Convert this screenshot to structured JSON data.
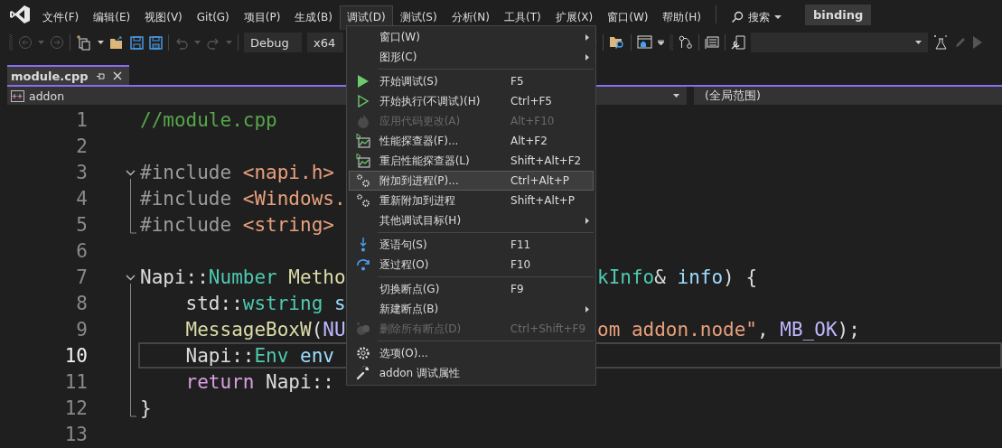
{
  "menubar": {
    "items": [
      {
        "label": "文件(F)",
        "selected": false
      },
      {
        "label": "编辑(E)",
        "selected": false
      },
      {
        "label": "视图(V)",
        "selected": false
      },
      {
        "label": "Git(G)",
        "selected": false
      },
      {
        "label": "项目(P)",
        "selected": false
      },
      {
        "label": "生成(B)",
        "selected": false
      },
      {
        "label": "调试(D)",
        "selected": true
      },
      {
        "label": "测试(S)",
        "selected": false
      },
      {
        "label": "分析(N)",
        "selected": false
      },
      {
        "label": "工具(T)",
        "selected": false
      },
      {
        "label": "扩展(X)",
        "selected": false
      },
      {
        "label": "窗口(W)",
        "selected": false
      },
      {
        "label": "帮助(H)",
        "selected": false
      }
    ],
    "search": {
      "label": "搜索"
    },
    "solution": "binding"
  },
  "toolbar": {
    "configuration": "Debug",
    "platform": "x64"
  },
  "tabs": [
    {
      "label": "module.cpp",
      "selected": true
    }
  ],
  "navbar": {
    "project": "addon",
    "scope": "(全局范围)"
  },
  "editor": {
    "lines": [
      {
        "number": "1",
        "current": false,
        "left": [
          {
            "text": "//module.cpp",
            "kind": "comment"
          }
        ]
      },
      {
        "number": "2",
        "current": false
      },
      {
        "number": "3",
        "current": false,
        "fold_open": true,
        "left": [
          {
            "text": "#include ",
            "kind": "preproc"
          },
          {
            "text": "<napi.h>",
            "kind": "string"
          }
        ]
      },
      {
        "number": "4",
        "current": false,
        "fold_guide": true,
        "left": [
          {
            "text": "#include ",
            "kind": "preproc"
          },
          {
            "text": "<Windows.",
            "kind": "string"
          }
        ]
      },
      {
        "number": "5",
        "current": false,
        "fold_end": true,
        "left": [
          {
            "text": "#include ",
            "kind": "preproc"
          },
          {
            "text": "<string>",
            "kind": "string"
          }
        ]
      },
      {
        "number": "6",
        "current": false
      },
      {
        "number": "7",
        "current": false,
        "fold_open": true,
        "left": [
          {
            "text": "Napi::",
            "kind": "plain"
          },
          {
            "text": "Number",
            "kind": "type"
          },
          {
            "text": " Metho",
            "kind": "function"
          }
        ],
        "right": [
          {
            "text": "kInfo",
            "kind": "type"
          },
          {
            "text": "& ",
            "kind": "plain"
          },
          {
            "text": "info",
            "kind": "param"
          },
          {
            "text": ") {",
            "kind": "plain"
          }
        ]
      },
      {
        "number": "8",
        "current": false,
        "fold_guide": true,
        "left": [
          {
            "text": "    std::",
            "kind": "plain"
          },
          {
            "text": "wstring",
            "kind": "type"
          },
          {
            "text": " s",
            "kind": "param"
          }
        ]
      },
      {
        "number": "9",
        "current": false,
        "fold_guide": true,
        "left": [
          {
            "text": "    MessageBoxW",
            "kind": "function"
          },
          {
            "text": "(",
            "kind": "plain"
          },
          {
            "text": "NU",
            "kind": "macro"
          }
        ],
        "right": [
          {
            "text": "om addon.node\"",
            "kind": "string"
          },
          {
            "text": ", ",
            "kind": "plain"
          },
          {
            "text": "MB_OK",
            "kind": "macro"
          },
          {
            "text": ");",
            "kind": "plain"
          }
        ]
      },
      {
        "number": "10",
        "current": true,
        "fold_guide": true,
        "left": [
          {
            "text": "    Napi::",
            "kind": "plain"
          },
          {
            "text": "Env",
            "kind": "type"
          },
          {
            "text": " env",
            "kind": "param"
          }
        ]
      },
      {
        "number": "11",
        "current": false,
        "fold_guide": true,
        "left": [
          {
            "text": "    return",
            "kind": "control"
          },
          {
            "text": " Napi::",
            "kind": "plain"
          }
        ]
      },
      {
        "number": "12",
        "current": false,
        "fold_end": true,
        "left": [
          {
            "text": "}",
            "kind": "plain"
          }
        ]
      },
      {
        "number": "13",
        "current": false
      }
    ]
  },
  "debug_menu": {
    "items": [
      {
        "kind": "plain",
        "label": "窗口(W)",
        "submenu": true,
        "disabled": false,
        "selected": false
      },
      {
        "kind": "plain",
        "label": "图形(C)",
        "submenu": true,
        "disabled": false,
        "selected": false
      },
      {
        "kind": "separator"
      },
      {
        "kind": "play",
        "label": "开始调试(S)",
        "shortcut": "F5",
        "submenu": false,
        "disabled": false,
        "selected": false
      },
      {
        "kind": "play-outline",
        "label": "开始执行(不调试)(H)",
        "shortcut": "Ctrl+F5",
        "submenu": false,
        "disabled": false,
        "selected": false
      },
      {
        "kind": "flame",
        "label": "应用代码更改(A)",
        "shortcut": "Alt+F10",
        "submenu": false,
        "disabled": true,
        "selected": false
      },
      {
        "kind": "chart",
        "label": "性能探查器(F)...",
        "shortcut": "Alt+F2",
        "submenu": false,
        "disabled": false,
        "selected": false
      },
      {
        "kind": "chart",
        "label": "重启性能探查器(L)",
        "shortcut": "Shift+Alt+F2",
        "submenu": false,
        "disabled": false,
        "selected": false
      },
      {
        "kind": "gears",
        "label": "附加到进程(P)...",
        "shortcut": "Ctrl+Alt+P",
        "submenu": false,
        "disabled": false,
        "selected": true
      },
      {
        "kind": "gears",
        "label": "重新附加到进程",
        "shortcut": "Shift+Alt+P",
        "submenu": false,
        "disabled": false,
        "selected": false
      },
      {
        "kind": "plain",
        "label": "其他调试目标(H)",
        "submenu": true,
        "disabled": false,
        "selected": false
      },
      {
        "kind": "separator"
      },
      {
        "kind": "step-into",
        "label": "逐语句(S)",
        "shortcut": "F11",
        "submenu": false,
        "disabled": false,
        "selected": false
      },
      {
        "kind": "step-over",
        "label": "逐过程(O)",
        "shortcut": "F10",
        "submenu": false,
        "disabled": false,
        "selected": false
      },
      {
        "kind": "separator"
      },
      {
        "kind": "plain",
        "label": "切换断点(G)",
        "shortcut": "F9",
        "submenu": false,
        "disabled": false,
        "selected": false
      },
      {
        "kind": "plain",
        "label": "新建断点(B)",
        "submenu": true,
        "disabled": false,
        "selected": false
      },
      {
        "kind": "breakpoints",
        "label": "删除所有断点(D)",
        "shortcut": "Ctrl+Shift+F9",
        "submenu": false,
        "disabled": true,
        "selected": false
      },
      {
        "kind": "separator"
      },
      {
        "kind": "settings",
        "label": "选项(O)...",
        "submenu": false,
        "disabled": false,
        "selected": false
      },
      {
        "kind": "wrench",
        "label": "addon 调试属性",
        "submenu": false,
        "disabled": false,
        "selected": false
      }
    ]
  }
}
